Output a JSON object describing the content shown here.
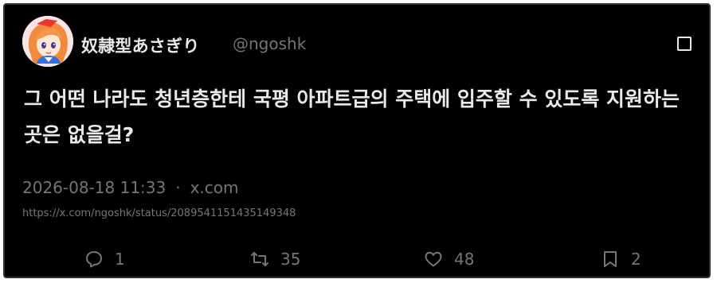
{
  "tweet": {
    "display_name": "奴隷型あさぎり",
    "handle": "@ngoshk",
    "text": "그 어떤 나라도 청년층한테 국평 아파트급의 주택에 입주할 수 있도록 지원하는 곳은 없을걸?",
    "timestamp": "2026-08-18 11:33",
    "separator": "·",
    "source": "x.com",
    "url": "https://x.com/ngoshk/status/2089541151435149348"
  },
  "actions": {
    "replies": "1",
    "retweets": "35",
    "likes": "48",
    "bookmarks": "2"
  },
  "icons": {
    "avatar": "anime-girl-avatar",
    "more": "more-options-icon",
    "reply": "reply-icon",
    "retweet": "retweet-icon",
    "like": "heart-icon",
    "bookmark": "bookmark-icon"
  },
  "colors": {
    "background": "#000000",
    "text": "#e7e9ea",
    "muted": "#71767b"
  }
}
